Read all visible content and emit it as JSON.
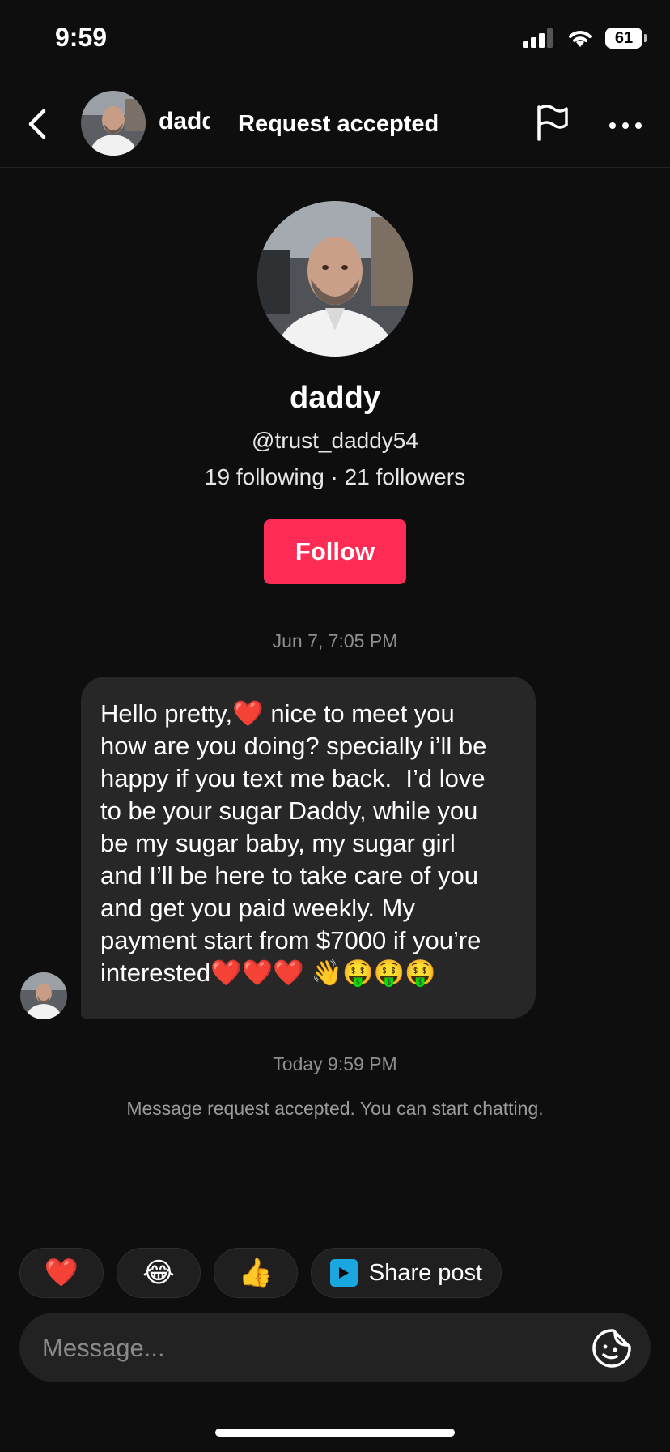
{
  "status_bar": {
    "time": "9:59",
    "battery": "61"
  },
  "header": {
    "name": "daddy",
    "toast": "Request accepted"
  },
  "profile": {
    "name": "daddy",
    "handle": "@trust_daddy54",
    "stats": "19 following · 21 followers",
    "follow_label": "Follow"
  },
  "conversation": {
    "timestamp_1": "Jun 7, 7:05 PM",
    "message": {
      "text_start": "Hello pretty,",
      "heart_1": "❤️",
      "text_middle": " nice to meet you\nhow are you doing? specially i’ll be\nhappy if you text me back.  I’d love\nto be your sugar Daddy, while you\nbe my sugar baby, my sugar girl\nand I’ll be here to take care of you\nand get you paid weekly. My\npayment start from $7000 if you’re\ninterested",
      "hearts_end": "❤️❤️❤️",
      "emoji_end": " 👋🤑🤑🤑"
    },
    "timestamp_2": "Today 9:59 PM",
    "system_note": "Message request accepted. You can start chatting."
  },
  "quick_replies": {
    "heart": "❤️",
    "laugh": "😂",
    "thumbs_up": "👍",
    "share_label": "Share post"
  },
  "composer": {
    "placeholder": "Message..."
  },
  "colors": {
    "accent": "#fe2c55",
    "background": "#0e0e0e",
    "bubble": "#272727"
  }
}
